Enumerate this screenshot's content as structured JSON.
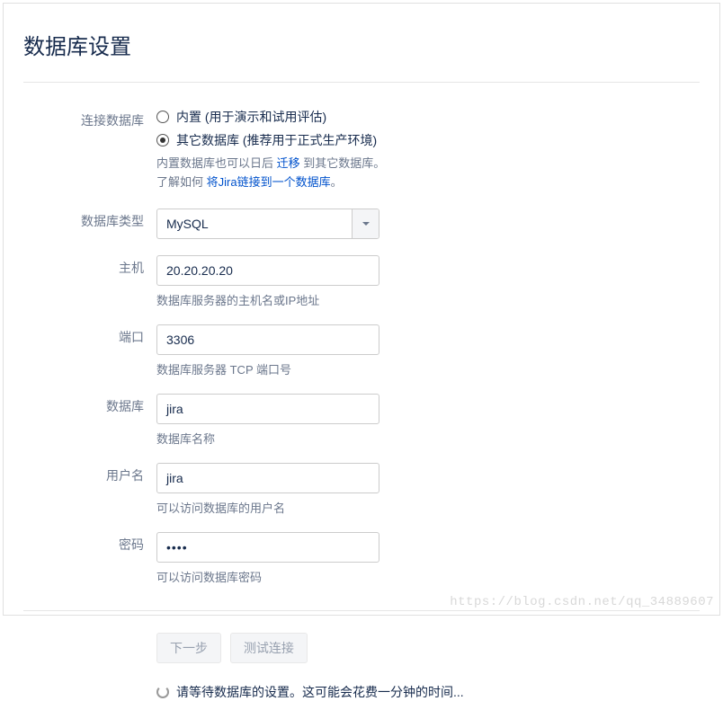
{
  "title": "数据库设置",
  "form": {
    "connect_label": "连接数据库",
    "radio_builtin": "内置 (用于演示和试用评估)",
    "radio_other": "其它数据库 (推荐用于正式生产环境)",
    "hint1_part1": "内置数据库也可以日后 ",
    "hint1_link": "迁移",
    "hint1_part2": " 到其它数据库。",
    "hint2_part1": "了解如何 ",
    "hint2_link": "将Jira链接到一个数据库",
    "hint2_part2": "。",
    "dbtype_label": "数据库类型",
    "dbtype_value": "MySQL",
    "host_label": "主机",
    "host_value": "20.20.20.20",
    "host_help": "数据库服务器的主机名或IP地址",
    "port_label": "端口",
    "port_value": "3306",
    "port_help": "数据库服务器 TCP 端口号",
    "db_label": "数据库",
    "db_value": "jira",
    "db_help": "数据库名称",
    "user_label": "用户名",
    "user_value": "jira",
    "user_help": "可以访问数据库的用户名",
    "pass_label": "密码",
    "pass_value": "••••",
    "pass_help": "可以访问数据库密码"
  },
  "buttons": {
    "next": "下一步",
    "test": "测试连接"
  },
  "status": "请等待数据库的设置。这可能会花费一分钟的时间...",
  "watermark": "https://blog.csdn.net/qq_34889607"
}
